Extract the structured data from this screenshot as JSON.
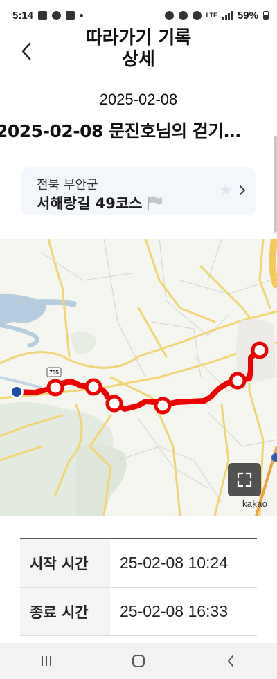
{
  "status_bar": {
    "time": "5:14",
    "battery": "59%",
    "network": "LTE"
  },
  "header": {
    "title_line1": "따라가기 기록",
    "title_line2": "상세",
    "back_icon": "chevron-left-icon"
  },
  "record": {
    "date": "2025-02-08",
    "title": "2025-02-08 문진호님의 걷기…"
  },
  "course": {
    "region": "전북 부안군",
    "name": "서해랑길 49코스",
    "flag_icon": "flag-icon",
    "star_icon": "star-icon",
    "chevron_icon": "chevron-right-icon"
  },
  "map": {
    "road_badge": "705",
    "attribution": "kakao",
    "start_point_color": "#1e4aa8",
    "route_color": "#ee0000",
    "expand_icon": "fullscreen-icon"
  },
  "info": {
    "rows": [
      {
        "label": "시작 시간",
        "value": "25-02-08 10:24"
      },
      {
        "label": "종료 시간",
        "value": "25-02-08 16:33"
      }
    ]
  },
  "nav": {
    "recents_icon": "recent-apps-icon",
    "home_icon": "home-icon",
    "back_icon": "back-icon"
  }
}
